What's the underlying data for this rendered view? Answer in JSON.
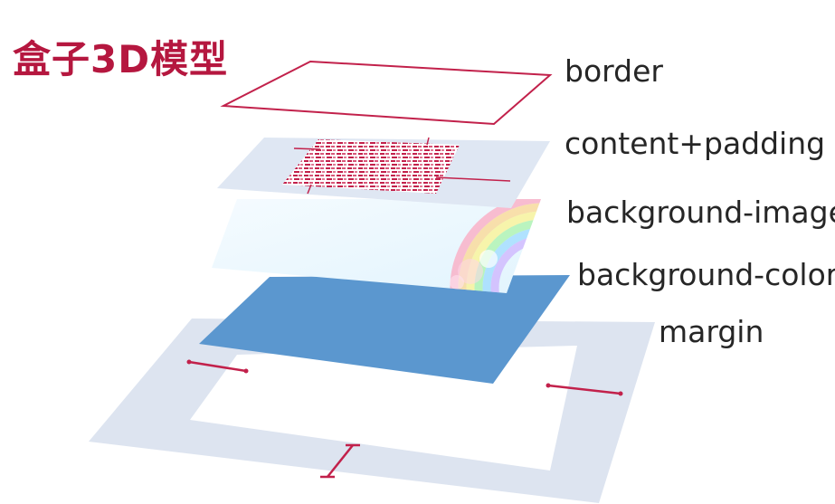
{
  "title": "盒子3D模型",
  "layers": [
    {
      "id": "border",
      "label": "border",
      "color": "#c2214b"
    },
    {
      "id": "content-padding",
      "label": "content+padding",
      "color": "#dfe7f3"
    },
    {
      "id": "background-image",
      "label": "background-image",
      "color": "#e8f6fd"
    },
    {
      "id": "background-color",
      "label": "background-color",
      "color": "#5b97cf"
    },
    {
      "id": "margin",
      "label": "margin",
      "color": "#dde4f0"
    }
  ],
  "colors": {
    "title": "#b5173f",
    "accent_line": "#c2214b",
    "label_text": "#262626"
  }
}
